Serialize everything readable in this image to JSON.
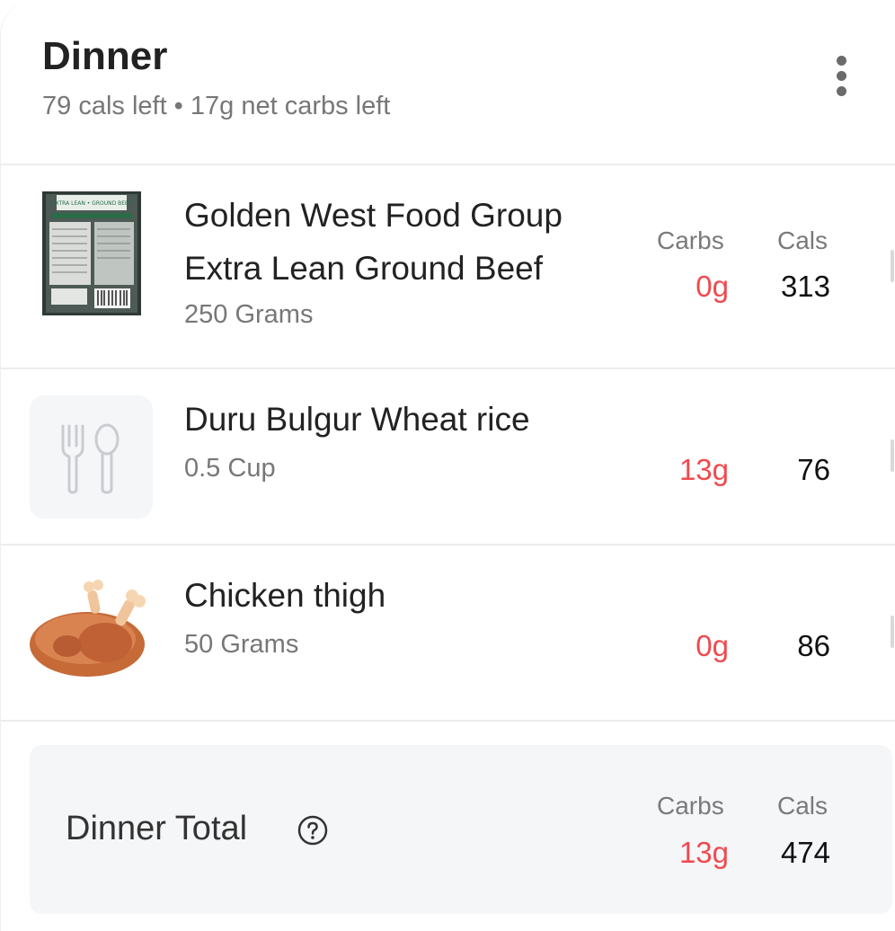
{
  "header": {
    "title": "Dinner",
    "subtitle": "79 cals left • 17g net carbs left",
    "menu_icon": "more-vertical-icon"
  },
  "columns": {
    "carbs": "Carbs",
    "cals": "Cals"
  },
  "items": [
    {
      "name_line1": "Golden West Food Group",
      "name_line2": "Extra Lean Ground Beef",
      "portion": "250 Grams",
      "carbs": "0g",
      "cals": "313",
      "thumb": "ground-beef-package-image",
      "package_text": "EXTRA LEAN • GROUND BEEF"
    },
    {
      "name_line1": "Duru Bulgur Wheat rice",
      "portion": "0.5 Cup",
      "carbs": "13g",
      "cals": "76",
      "thumb": "fork-spoon-icon"
    },
    {
      "name_line1": "Chicken thigh",
      "portion": "50 Grams",
      "carbs": "0g",
      "cals": "86",
      "thumb": "roast-chicken-image"
    }
  ],
  "total": {
    "label": "Dinner Total",
    "carbs": "13g",
    "cals": "474",
    "help_icon": "question-circle-icon"
  },
  "colors": {
    "carbs_red": "#f04a4f",
    "title_text": "#222222",
    "muted_text": "#777777",
    "total_bg": "#f5f6f8"
  }
}
